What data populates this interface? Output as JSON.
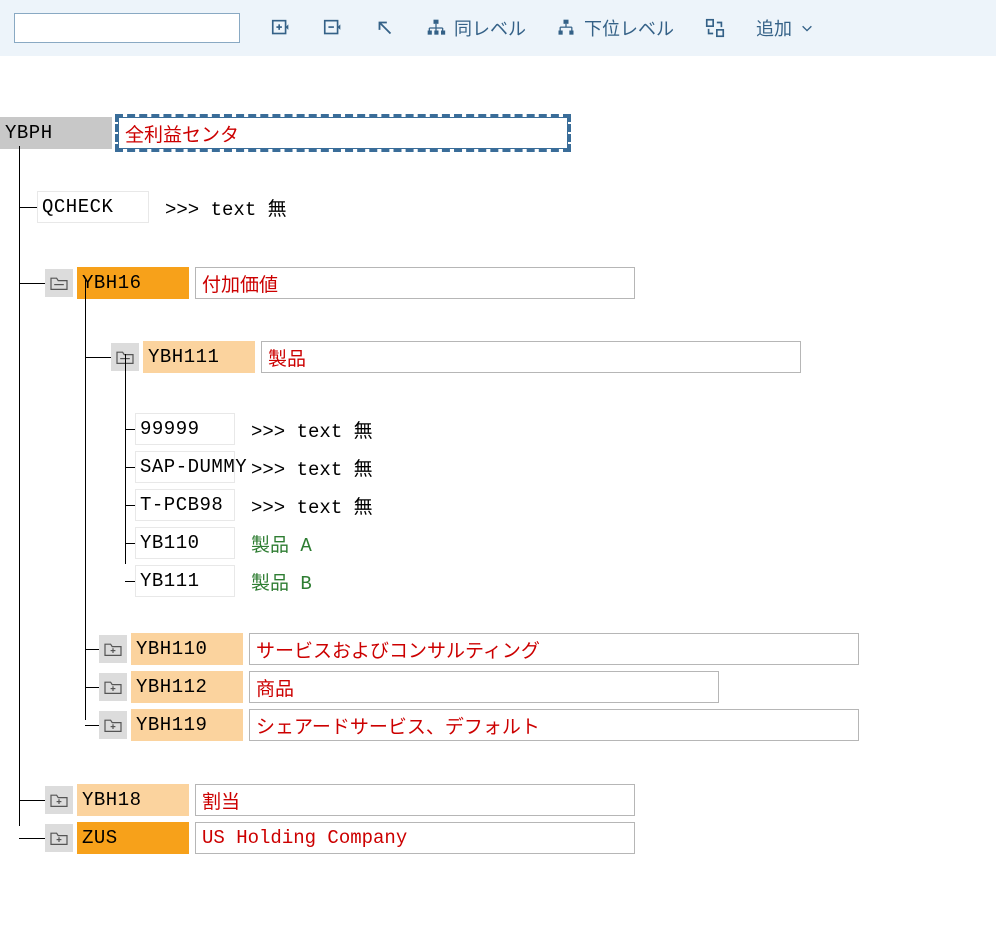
{
  "toolbar": {
    "same_level": "同レベル",
    "sub_level": "下位レベル",
    "add": "追加"
  },
  "tree": {
    "root": {
      "code": "YBPH",
      "desc": "全利益センタ"
    },
    "qcheck": {
      "code": "QCHECK",
      "desc": ">>> text 無"
    },
    "ybh16": {
      "code": "YBH16",
      "desc": "付加価値"
    },
    "ybh111": {
      "code": "YBH111",
      "desc": "製品"
    },
    "leaves": [
      {
        "code": "99999",
        "desc": ">>> text 無",
        "style": "no"
      },
      {
        "code": "SAP-DUMMY",
        "desc": ">>> text 無",
        "style": "no"
      },
      {
        "code": "T-PCB98",
        "desc": ">>> text 無",
        "style": "no"
      },
      {
        "code": "YB110",
        "desc": "製品 A",
        "style": "green"
      },
      {
        "code": "YB111",
        "desc": "製品 B",
        "style": "green"
      }
    ],
    "ybh110": {
      "code": "YBH110",
      "desc": "サービスおよびコンサルティング"
    },
    "ybh112": {
      "code": "YBH112",
      "desc": "商品"
    },
    "ybh119": {
      "code": "YBH119",
      "desc": "シェアードサービス、デフォルト"
    },
    "ybh18": {
      "code": "YBH18",
      "desc": "割当"
    },
    "zus": {
      "code": "ZUS",
      "desc": "US Holding Company"
    }
  }
}
